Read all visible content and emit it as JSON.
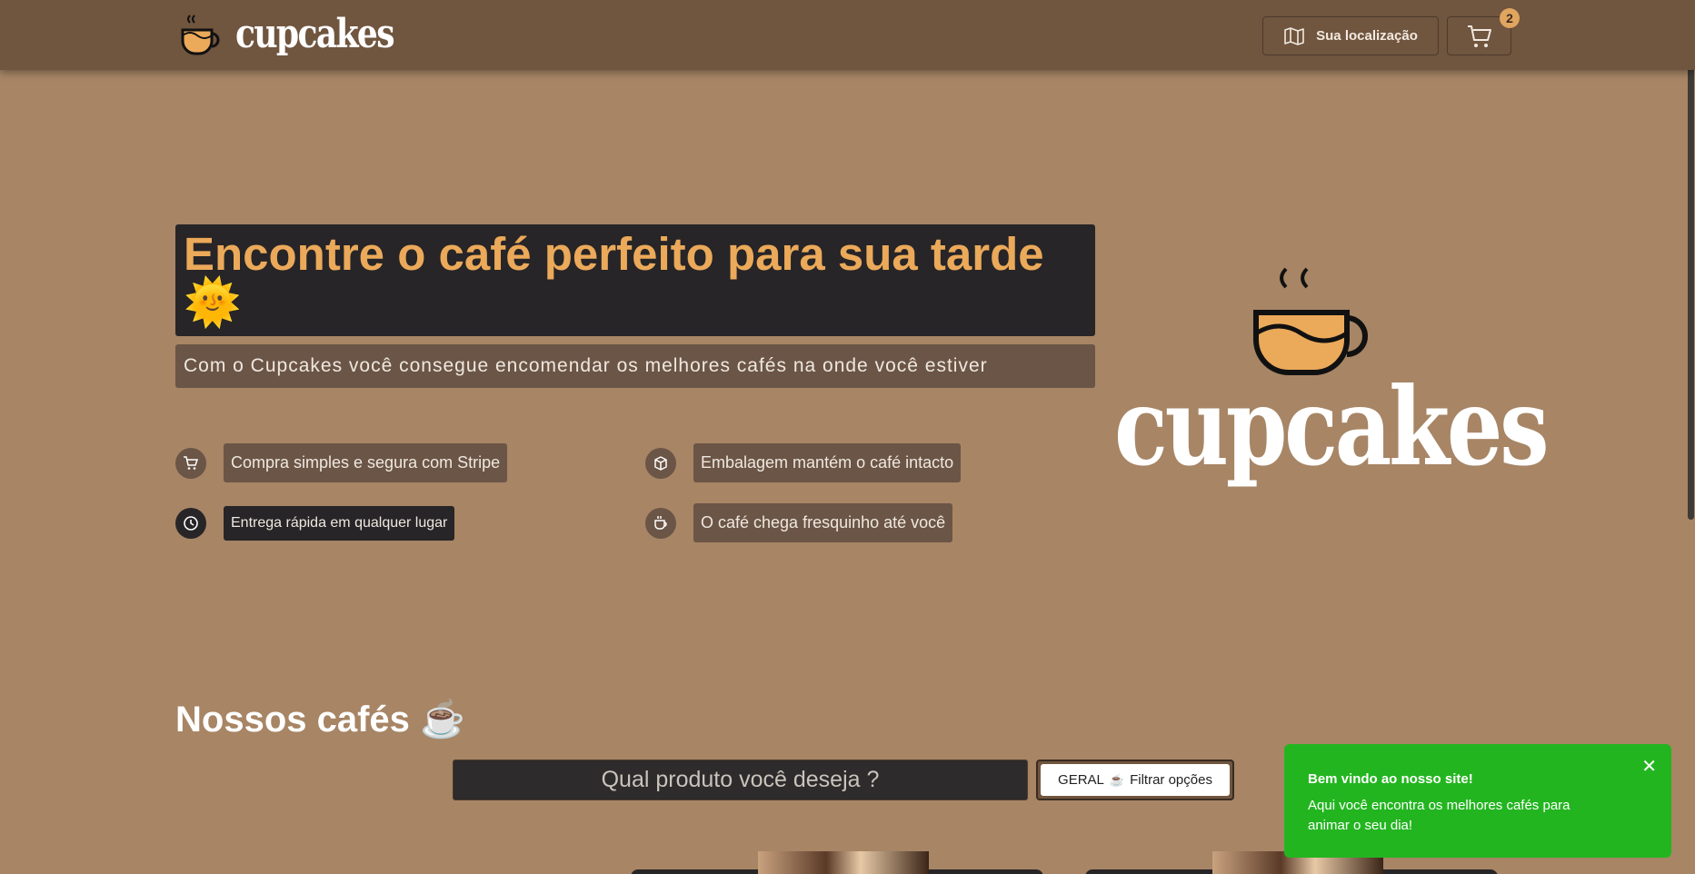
{
  "header": {
    "logo_text": "cupcakes",
    "location_label": "Sua localização",
    "cart_count": "2"
  },
  "hero": {
    "title": "Encontre o café perfeito para sua tarde",
    "title_emoji": "🌞",
    "subtitle": "Com o Cupcakes você consegue encomendar os melhores cafés na onde você estiver",
    "features": [
      {
        "label": "Compra simples e segura com Stripe",
        "icon": "cart-icon"
      },
      {
        "label": "Embalagem mantém o café intacto",
        "icon": "package-icon"
      },
      {
        "label": "Entrega rápida em qualquer lugar",
        "icon": "clock-icon"
      },
      {
        "label": "O café chega fresquinho até você",
        "icon": "coffee-icon"
      }
    ],
    "big_logo_text": "cupcakes"
  },
  "catalog": {
    "title": "Nossos cafés",
    "title_emoji": "☕",
    "search_placeholder": "Qual produto você deseja ?",
    "filter_label": "GERAL",
    "filter_emoji": "☕",
    "filter_text": "Filtrar opções"
  },
  "toast": {
    "title": "Bem vindo ao nosso site!",
    "body": "Aqui você encontra os melhores cafés para animar o seu dia!",
    "close": "✕"
  },
  "colors": {
    "background": "#a78565",
    "header": "#70553f",
    "accent": "#eba95a",
    "dark": "#272527",
    "toast": "#23b520"
  }
}
